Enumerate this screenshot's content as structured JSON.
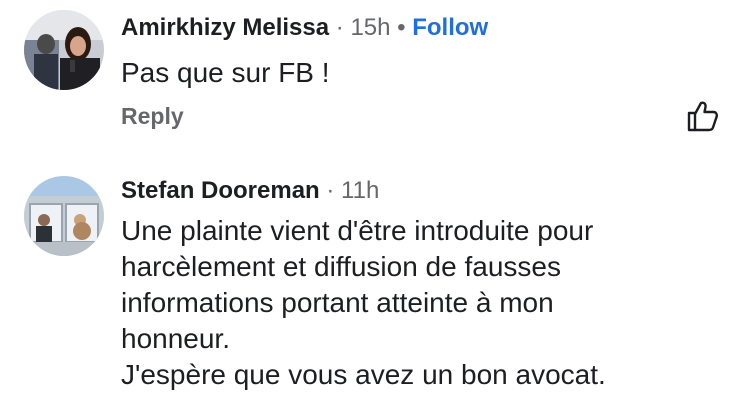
{
  "comments": [
    {
      "author": "Amirkhizy Melissa",
      "separator": "·",
      "time": "15h",
      "follow_separator": "•",
      "follow_label": "Follow",
      "text": "Pas que sur FB !",
      "reply_label": "Reply",
      "like_icon": "thumbs-up-icon"
    },
    {
      "author": "Stefan Dooreman",
      "separator": "·",
      "time": "11h",
      "text_lines": [
        "Une plainte vient d'être introduite pour",
        "harcèlement et diffusion de fausses",
        "informations portant atteinte à mon",
        "honneur.",
        "J'espère que vous avez un bon avocat."
      ]
    }
  ],
  "colors": {
    "text": "#1c1e21",
    "secondary": "#65676b",
    "link": "#216fdb",
    "background": "#ffffff"
  }
}
